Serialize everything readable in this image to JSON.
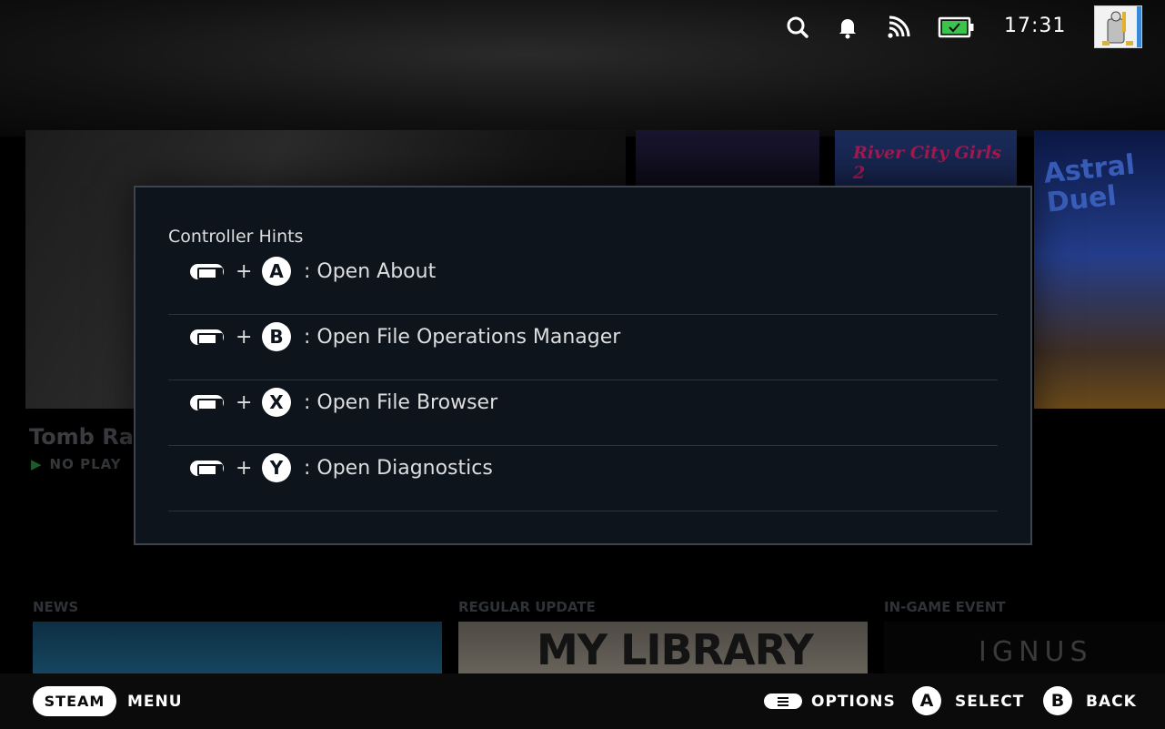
{
  "status_bar": {
    "time": "17:31",
    "icons": [
      "search-icon",
      "bell-icon",
      "wifi-icon",
      "battery-icon"
    ],
    "battery_color": "#3cc34d"
  },
  "background": {
    "game_title": "Tomb Ra",
    "game_status": "NO PLAY",
    "tile_titles": [
      "River City Girls 2",
      "Astral Duel"
    ],
    "sections": [
      "NEWS",
      "REGULAR UPDATE",
      "IN-GAME EVENT"
    ],
    "thumb_texts": [
      "MY LIBRARY",
      "IGNUS"
    ]
  },
  "modal": {
    "title": "Controller Hints",
    "hints": [
      {
        "button": "A",
        "label": ": Open About"
      },
      {
        "button": "B",
        "label": ": Open File Operations Manager"
      },
      {
        "button": "X",
        "label": ": Open File Browser"
      },
      {
        "button": "Y",
        "label": ": Open Diagnostics"
      }
    ],
    "plus": "+"
  },
  "footer": {
    "steam_label": "STEAM",
    "menu_label": "MENU",
    "options_label": "OPTIONS",
    "select_button": "A",
    "select_label": "SELECT",
    "back_button": "B",
    "back_label": "BACK"
  }
}
